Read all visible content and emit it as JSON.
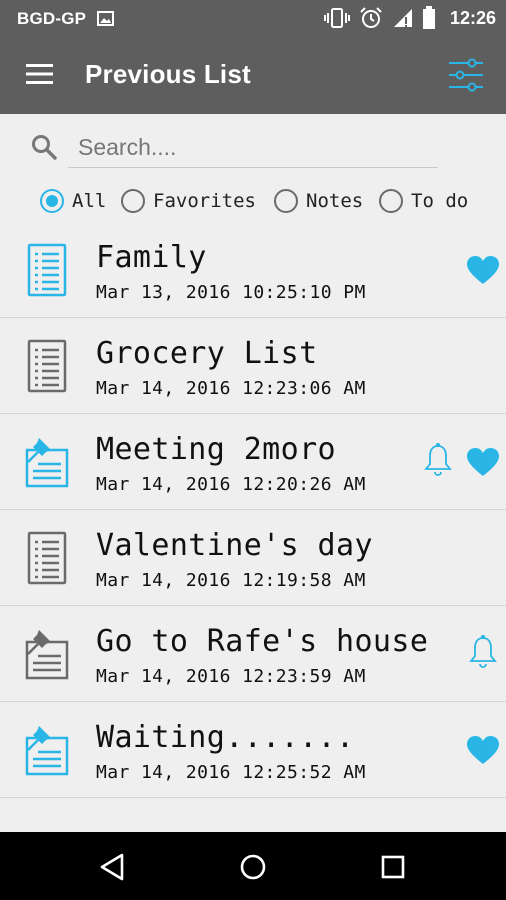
{
  "status_bar": {
    "carrier": "BGD-GP",
    "time": "12:26",
    "icons": [
      "image-icon",
      "vibrate-icon",
      "alarm-icon",
      "signal-icon",
      "battery-icon"
    ]
  },
  "app_bar": {
    "title": "Previous List",
    "menu_icon": "hamburger-menu-icon",
    "filter_icon": "sliders-filter-icon"
  },
  "search": {
    "placeholder": "Search....",
    "value": ""
  },
  "filters": {
    "selected": "All",
    "options": [
      "All",
      "Favorites",
      "Notes",
      "To do"
    ]
  },
  "colors": {
    "accent": "#29b6e6",
    "bar": "#5e5e5e",
    "background": "#efefef",
    "gray_icon": "#6a6a6a"
  },
  "items": [
    {
      "title": "Family",
      "date": "Mar 13, 2016 10:25:10 PM",
      "type": "note",
      "icon_color": "blue",
      "favorite": true,
      "reminder": false
    },
    {
      "title": "Grocery List",
      "date": "Mar 14, 2016 12:23:06 AM",
      "type": "note",
      "icon_color": "gray",
      "favorite": false,
      "reminder": false
    },
    {
      "title": "Meeting 2moro",
      "date": "Mar 14, 2016 12:20:26 AM",
      "type": "todo",
      "icon_color": "blue",
      "favorite": true,
      "reminder": true
    },
    {
      "title": "Valentine's day",
      "date": "Mar 14, 2016 12:19:58 AM",
      "type": "note",
      "icon_color": "gray",
      "favorite": false,
      "reminder": false
    },
    {
      "title": "Go to Rafe's house",
      "date": "Mar 14, 2016 12:23:59 AM",
      "type": "todo",
      "icon_color": "gray",
      "favorite": false,
      "reminder": true
    },
    {
      "title": "Waiting.......",
      "date": "Mar 14, 2016 12:25:52 AM",
      "type": "todo",
      "icon_color": "blue",
      "favorite": true,
      "reminder": false
    }
  ],
  "nav_bar": {
    "buttons": [
      "back-icon",
      "home-icon",
      "recents-icon"
    ]
  }
}
